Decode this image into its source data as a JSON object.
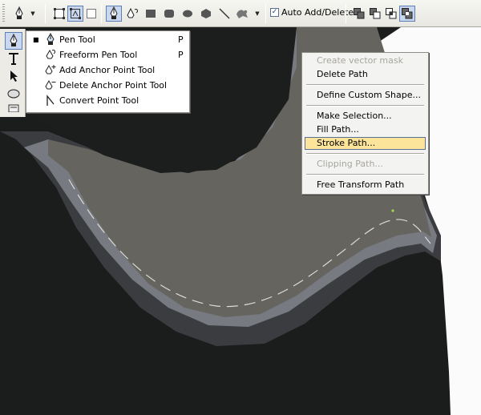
{
  "options_bar": {
    "tools": [
      {
        "name": "pen-tool-preset-icon"
      },
      {
        "name": "shape-layers-icon"
      },
      {
        "name": "paths-mode-icon"
      },
      {
        "name": "fill-pixels-icon"
      },
      {
        "name": "pen-icon"
      },
      {
        "name": "freeform-pen-icon"
      },
      {
        "name": "rectangle-icon"
      },
      {
        "name": "rounded-rectangle-icon"
      },
      {
        "name": "ellipse-icon"
      },
      {
        "name": "polygon-icon"
      },
      {
        "name": "line-icon"
      },
      {
        "name": "custom-shape-icon"
      }
    ],
    "auto_add_delete": {
      "label": "Auto Add/Delete",
      "checked": true
    },
    "path_operations": [
      "add-to-path-area-icon",
      "subtract-from-path-area-icon",
      "intersect-path-areas-icon",
      "exclude-overlapping-path-areas-icon"
    ]
  },
  "toolbox": {
    "items": [
      "pen-tool-icon",
      "type-tool-icon",
      "path-selection-icon",
      "ellipse-tool-icon",
      "notes-tool-icon"
    ]
  },
  "pen_flyout": {
    "items": [
      {
        "label": "Pen Tool",
        "shortcut": "P",
        "selected": true,
        "icon": "pen-icon"
      },
      {
        "label": "Freeform Pen Tool",
        "shortcut": "P",
        "selected": false,
        "icon": "freeform-pen-icon"
      },
      {
        "label": "Add Anchor Point Tool",
        "shortcut": "",
        "selected": false,
        "icon": "add-anchor-point-icon"
      },
      {
        "label": "Delete Anchor Point Tool",
        "shortcut": "",
        "selected": false,
        "icon": "delete-anchor-point-icon"
      },
      {
        "label": "Convert Point Tool",
        "shortcut": "",
        "selected": false,
        "icon": "convert-point-icon"
      }
    ]
  },
  "context_menu": {
    "items": [
      {
        "label": "Create vector mask",
        "disabled": true
      },
      {
        "label": "Delete Path",
        "disabled": false
      },
      {
        "label": "Define Custom Shape...",
        "disabled": false
      },
      {
        "label": "Make Selection...",
        "disabled": false
      },
      {
        "label": "Fill Path...",
        "disabled": false
      },
      {
        "label": "Stroke Path...",
        "disabled": false,
        "highlighted": true
      },
      {
        "label": "Clipping Path...",
        "disabled": true
      },
      {
        "label": "Free Transform Path",
        "disabled": false
      }
    ]
  },
  "colors": {
    "highlight": "#fce49a",
    "canvas_dark": "#1b1d1c",
    "shape_gray": "#66645f",
    "path_stroke": "#dcdcd6"
  }
}
